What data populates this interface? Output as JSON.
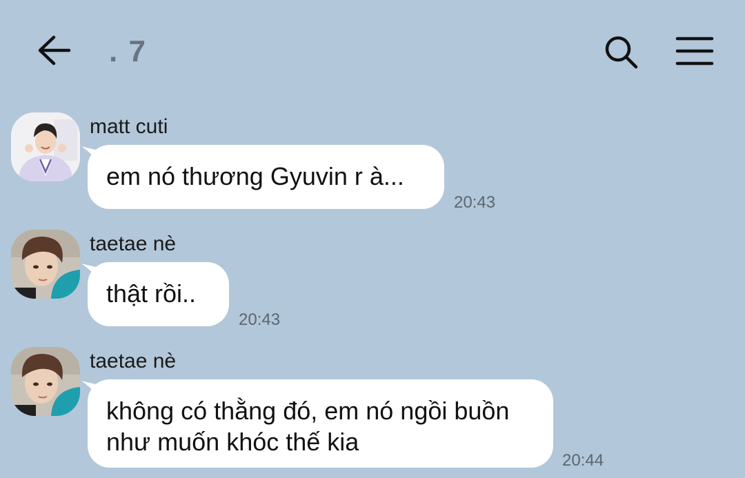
{
  "header": {
    "title": ". 7",
    "back_icon": "arrow-left-icon",
    "search_icon": "search-icon",
    "menu_icon": "hamburger-menu-icon"
  },
  "messages": [
    {
      "sender": "matt cuti",
      "text": "em nó thương Gyuvin r à...",
      "time": "20:43"
    },
    {
      "sender": "taetae nè",
      "text": "thật rồi..",
      "time": "20:43"
    },
    {
      "sender": "taetae nè",
      "text": "không có thằng đó, em nó ngồi buồn như muốn khóc thế kia",
      "time": "20:44"
    }
  ],
  "colors": {
    "background": "#b2c7d9",
    "bubble": "#ffffff",
    "time_text": "#5b6670",
    "title_text": "#6a7480"
  }
}
